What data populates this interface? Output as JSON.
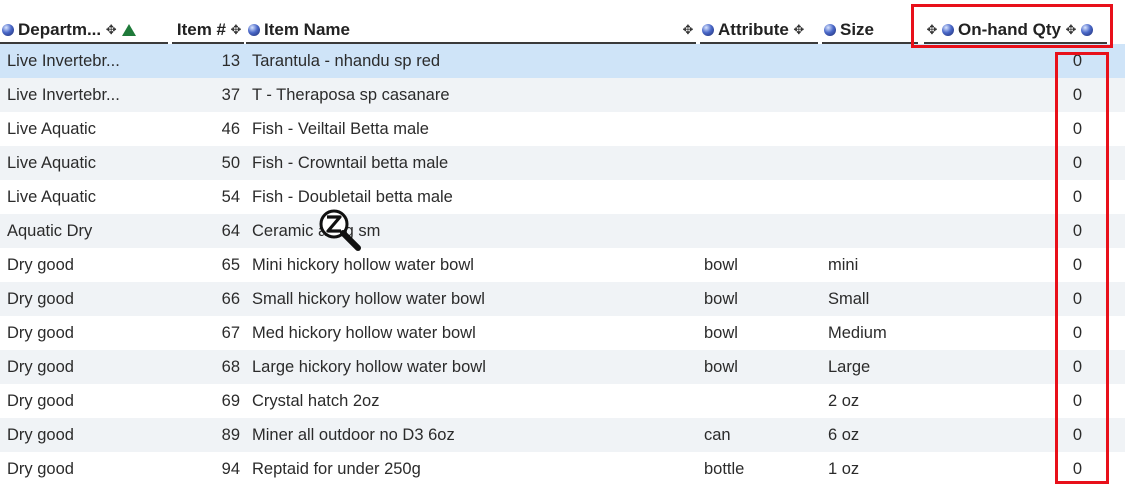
{
  "columns": {
    "department": "Departm...",
    "item_num": "Item #",
    "item_name": "Item Name",
    "attribute": "Attribute",
    "size": "Size",
    "onhand_qty": "On-hand Qty"
  },
  "rows": [
    {
      "department": "Live Invertebr...",
      "item_num": "13",
      "item_name": "Tarantula - nhandu sp red",
      "attribute": "",
      "size": "",
      "qty": "0"
    },
    {
      "department": "Live Invertebr...",
      "item_num": "37",
      "item_name": "T - Theraposa sp casanare",
      "attribute": "",
      "size": "",
      "qty": "0"
    },
    {
      "department": "Live Aquatic",
      "item_num": "46",
      "item_name": "Fish - Veiltail Betta male",
      "attribute": "",
      "size": "",
      "qty": "0"
    },
    {
      "department": "Live Aquatic",
      "item_num": "50",
      "item_name": "Fish - Crowntail betta male",
      "attribute": "",
      "size": "",
      "qty": "0"
    },
    {
      "department": "Live Aquatic",
      "item_num": "54",
      "item_name": "Fish - Doubletail betta male",
      "attribute": "",
      "size": "",
      "qty": "0"
    },
    {
      "department": "Aquatic Dry",
      "item_num": "64",
      "item_name": "Ceramic     a log sm",
      "attribute": "",
      "size": "",
      "qty": "0"
    },
    {
      "department": "Dry good",
      "item_num": "65",
      "item_name": "Mini hickory hollow water bowl",
      "attribute": "bowl",
      "size": "mini",
      "qty": "0"
    },
    {
      "department": "Dry good",
      "item_num": "66",
      "item_name": "Small hickory hollow water bowl",
      "attribute": "bowl",
      "size": "Small",
      "qty": "0"
    },
    {
      "department": "Dry good",
      "item_num": "67",
      "item_name": "Med hickory hollow water bowl",
      "attribute": "bowl",
      "size": "Medium",
      "qty": "0"
    },
    {
      "department": "Dry good",
      "item_num": "68",
      "item_name": "Large hickory hollow water bowl",
      "attribute": "bowl",
      "size": "Large",
      "qty": "0"
    },
    {
      "department": "Dry good",
      "item_num": "69",
      "item_name": "Crystal hatch 2oz",
      "attribute": "",
      "size": "2 oz",
      "qty": "0"
    },
    {
      "department": "Dry good",
      "item_num": "89",
      "item_name": "Miner all outdoor no D3 6oz",
      "attribute": "can",
      "size": "6 oz",
      "qty": "0"
    },
    {
      "department": "Dry good",
      "item_num": "94",
      "item_name": "Reptaid for under 250g",
      "attribute": "bottle",
      "size": "1 oz",
      "qty": "0"
    }
  ],
  "selected_row": 0,
  "colors": {
    "selected_row": "#cfe4f8",
    "alt_row": "#f0f3f6",
    "highlight": "#e8101a",
    "sort_indicator": "#1f7a3a"
  },
  "icons": {
    "column_ball": "blue-ball-icon",
    "column_move": "move-arrows-icon",
    "sort": "sort-ascending-triangle-icon",
    "cursor": "zoom-cursor-icon"
  }
}
